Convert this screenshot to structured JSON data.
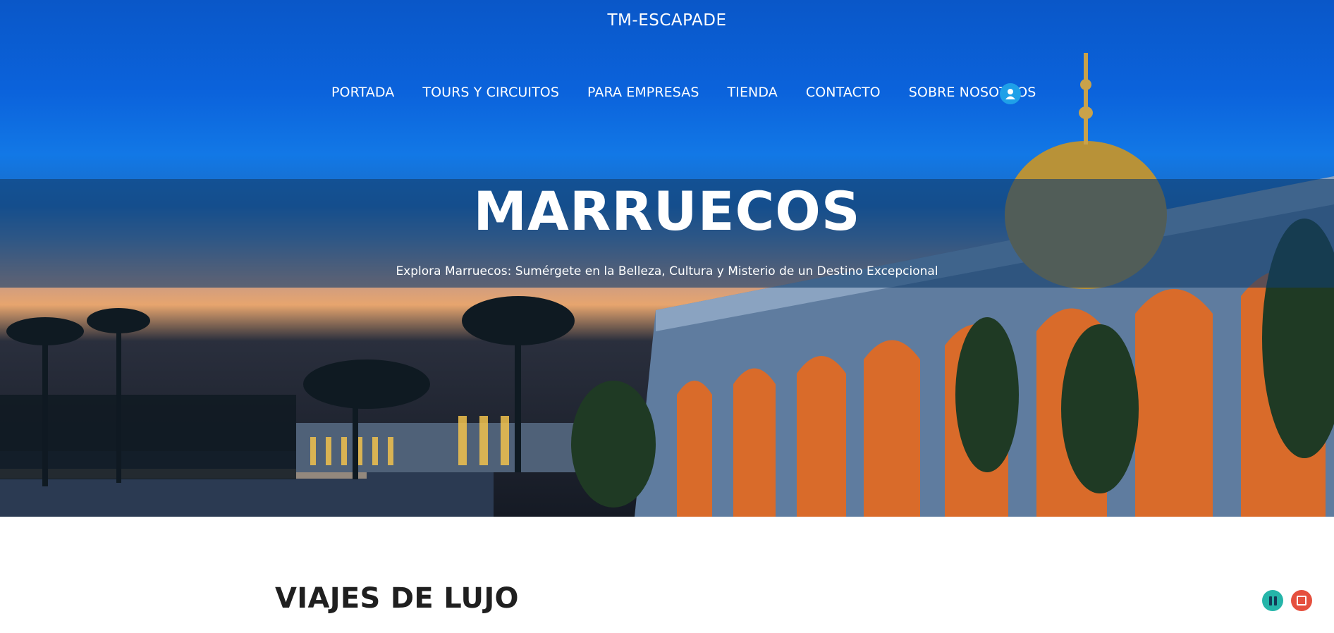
{
  "header": {
    "site_title": "TM-ESCAPADE"
  },
  "nav": {
    "items": [
      {
        "label": "PORTADA"
      },
      {
        "label": "TOURS Y CIRCUITOS"
      },
      {
        "label": "PARA EMPRESAS"
      },
      {
        "label": "TIENDA"
      },
      {
        "label": "CONTACTO"
      },
      {
        "label": "SOBRE NOSOTROS"
      }
    ],
    "user_icon": "user-account-icon"
  },
  "hero": {
    "title": "MARRUECOS",
    "subtitle": "Explora Marruecos: Sumérgete en la Belleza, Cultura y Misterio de un Destino Excepcional"
  },
  "main": {
    "section_heading": "VIAJES DE LUJO"
  },
  "media_controls": {
    "pause_icon": "pause-icon",
    "stop_icon": "stop-icon"
  },
  "colors": {
    "sky_top": "#0a57c8",
    "band_overlay": "#123e6c",
    "user_button": "#1fa0e8",
    "pause_button": "#25b5a9",
    "stop_button": "#e5503e",
    "heading_text": "#1f1f1f"
  }
}
